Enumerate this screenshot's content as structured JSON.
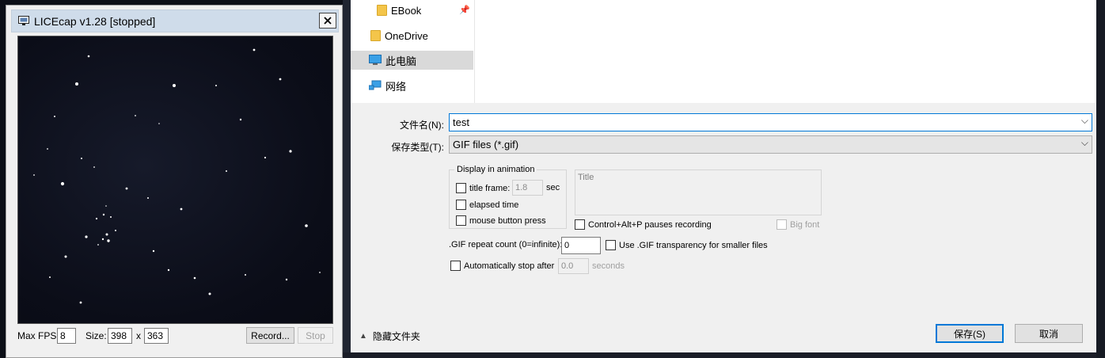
{
  "licecap": {
    "title": "LICEcap v1.28 [stopped]",
    "max_fps_label": "Max FPS:",
    "max_fps_value": "8",
    "size_label": "Size:",
    "width_value": "398",
    "x_label": "x",
    "height_value": "363",
    "record_button": "Record...",
    "stop_button": "Stop"
  },
  "save_dialog": {
    "nav_items": [
      {
        "label": "EBook",
        "icon": "folder-icon",
        "pinned": true
      },
      {
        "label": "OneDrive",
        "icon": "folder-icon"
      },
      {
        "label": "此电脑",
        "icon": "computer-icon",
        "selected": true
      },
      {
        "label": "网络",
        "icon": "network-icon"
      }
    ],
    "filename_label": "文件名(N):",
    "filename_value": "test",
    "filetype_label": "保存类型(T):",
    "filetype_value": "GIF files (*.gif)",
    "display_group_title": "Display in animation",
    "title_frame_label": "title frame:",
    "title_frame_value": "1.8",
    "title_frame_unit": "sec",
    "elapsed_time_label": "elapsed time",
    "mouse_button_press_label": "mouse button press",
    "title_placeholder": "Title",
    "pause_shortcut_label": "Control+Alt+P pauses recording",
    "big_font_label": "Big font",
    "repeat_count_label": ".GIF repeat count (0=infinite):",
    "repeat_count_value": "0",
    "transparency_label": "Use .GIF transparency for smaller files",
    "auto_stop_label": "Automatically stop after",
    "auto_stop_value": "0.0",
    "auto_stop_unit": "seconds",
    "hide_folders_label": "隐藏文件夹",
    "save_button": "保存(S)",
    "cancel_button": "取消"
  }
}
